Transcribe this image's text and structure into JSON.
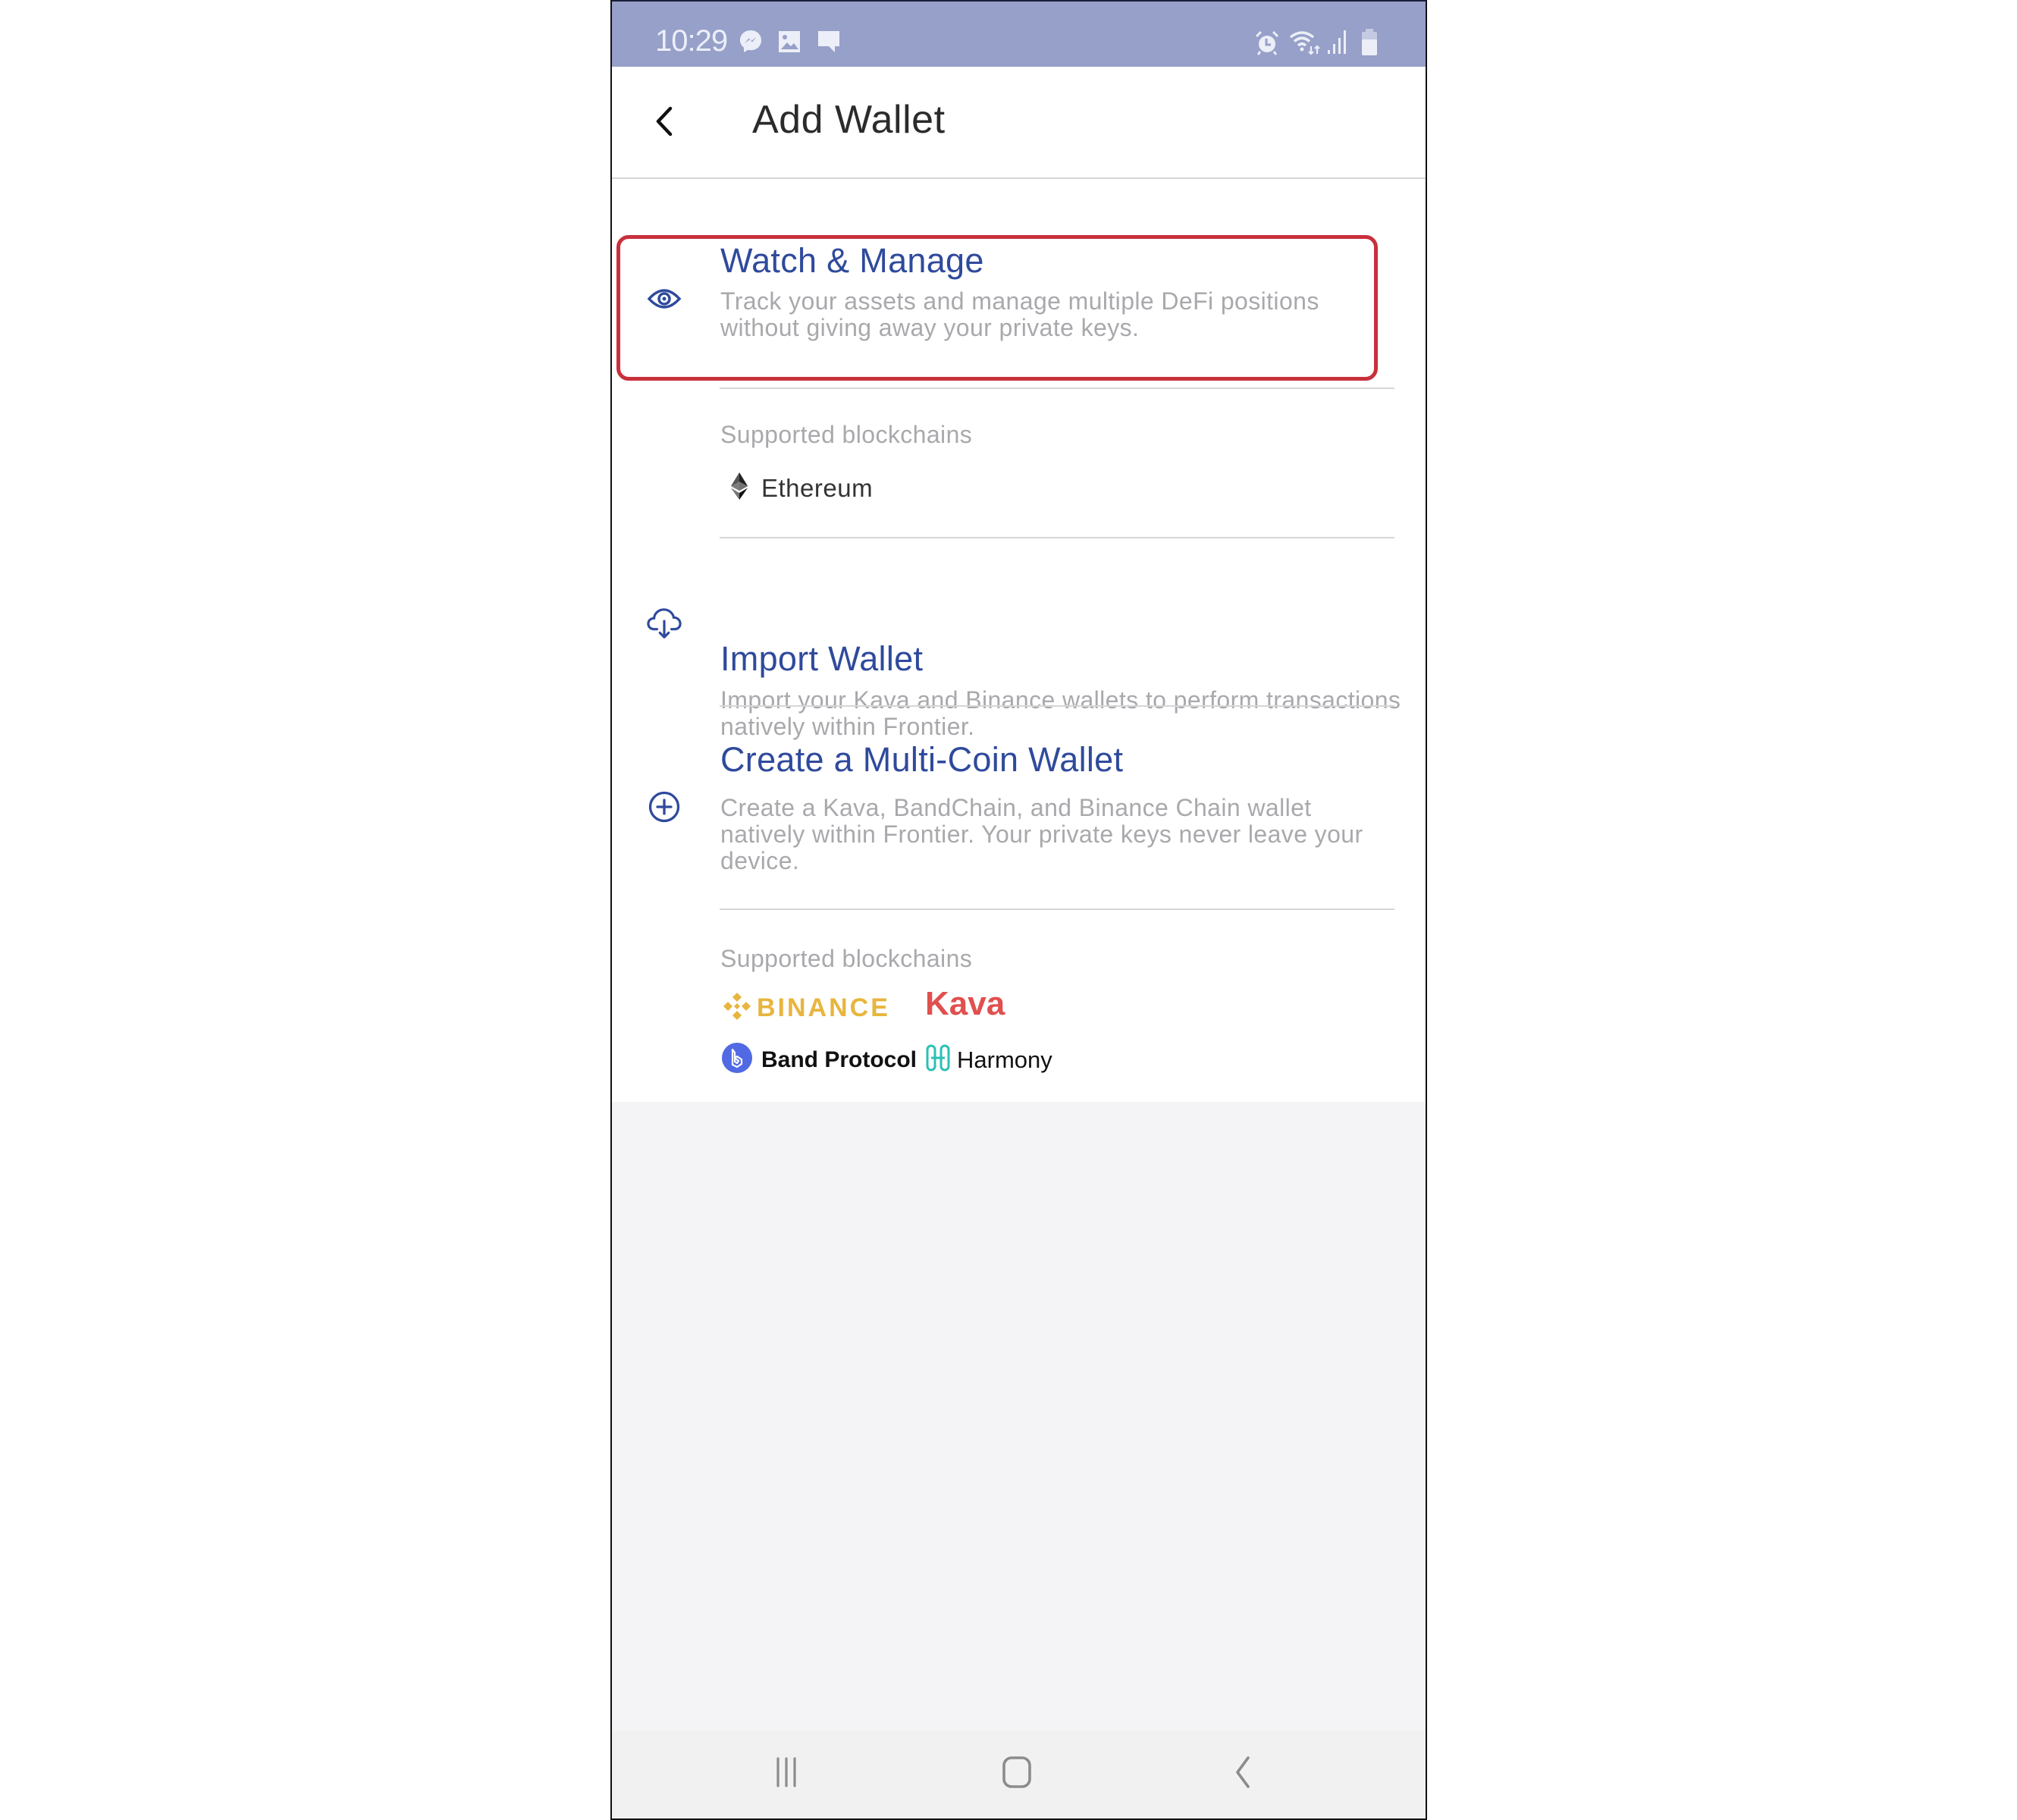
{
  "status_bar": {
    "time": "10:29",
    "left_icons": [
      "messenger-icon",
      "gallery-icon",
      "message-icon"
    ],
    "right_icons": [
      "alarm-icon",
      "wifi-icon",
      "signal-icon",
      "battery-icon"
    ],
    "background_color": "#96a0c8"
  },
  "header": {
    "title": "Add Wallet",
    "back_icon": "chevron-left-icon"
  },
  "options": [
    {
      "id": "watch-manage",
      "icon": "eye-icon",
      "title": "Watch & Manage",
      "description": "Track your assets and manage multiple DeFi positions without giving away your private keys.",
      "highlighted": true
    },
    {
      "id": "import-wallet",
      "icon": "cloud-download-icon",
      "title": "Import Wallet",
      "description": "Import your Kava and Binance wallets to perform transactions natively within Frontier."
    },
    {
      "id": "create-multi-coin",
      "icon": "plus-circle-icon",
      "title": "Create a Multi-Coin Wallet",
      "description": "Create a Kava, BandChain, and Binance Chain wallet natively within Frontier. Your private keys never leave your device."
    }
  ],
  "watch_supported": {
    "label": "Supported blockchains",
    "chains": [
      {
        "name": "Ethereum",
        "icon": "ethereum-icon"
      }
    ]
  },
  "create_supported": {
    "label": "Supported blockchains",
    "chains": [
      {
        "name": "BINANCE",
        "icon": "binance-icon",
        "color": "#e8b53e"
      },
      {
        "name": "Kava",
        "icon": "kava-logo",
        "color": "#e0504f"
      },
      {
        "name": "Band Protocol",
        "icon": "band-protocol-icon",
        "color": "#5169e3"
      },
      {
        "name": "Harmony",
        "icon": "harmony-icon",
        "color": "#2bc0b4"
      }
    ]
  },
  "colors": {
    "accent": "#2f4a9c",
    "highlight": "#c8303c",
    "muted_text": "#a9a9ad"
  },
  "nav_bar": {
    "buttons": [
      "recent-apps-icon",
      "home-icon",
      "back-icon"
    ]
  }
}
